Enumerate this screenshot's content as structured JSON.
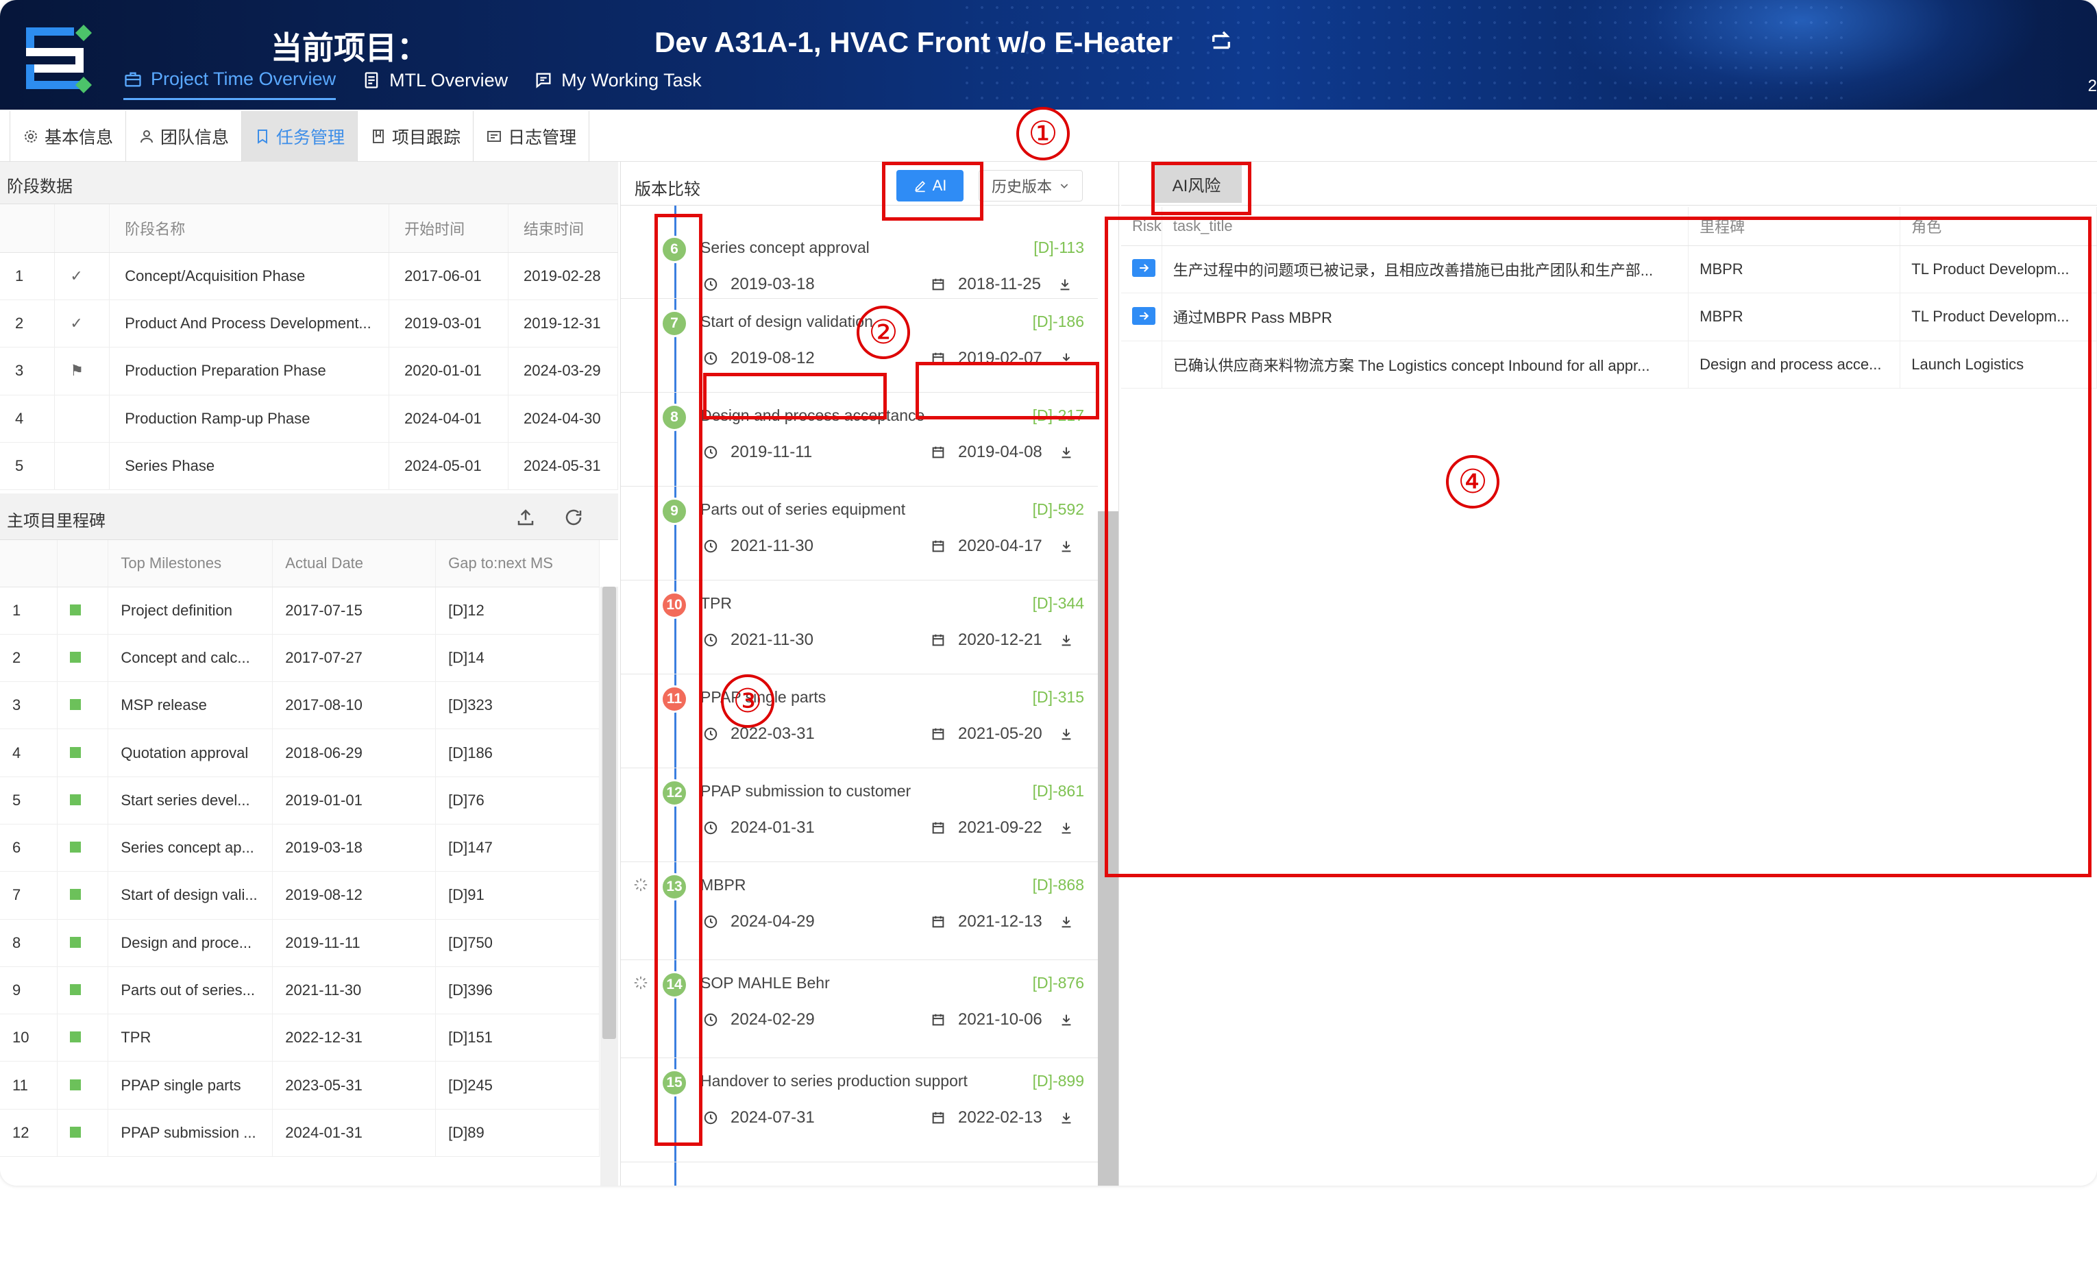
{
  "header": {
    "project_label": "当前项目：",
    "project_name": "Dev A31A-1, HVAC Front w/o E-Heater",
    "nav": [
      {
        "label": "Project Time Overview",
        "icon": "briefcase-icon",
        "active": true
      },
      {
        "label": "MTL Overview",
        "icon": "document-icon",
        "active": false
      },
      {
        "label": "My Working Task",
        "icon": "message-icon",
        "active": false
      }
    ],
    "right_number": "2"
  },
  "subtabs": [
    {
      "label": "基本信息",
      "icon": "gear-icon",
      "active": false
    },
    {
      "label": "团队信息",
      "icon": "user-icon",
      "active": false
    },
    {
      "label": "任务管理",
      "icon": "bookmark-icon",
      "active": true
    },
    {
      "label": "项目跟踪",
      "icon": "tracking-icon",
      "active": false
    },
    {
      "label": "日志管理",
      "icon": "log-icon",
      "active": false
    }
  ],
  "stage": {
    "title": "阶段数据",
    "columns": [
      "",
      "",
      "阶段名称",
      "开始时间",
      "结束时间"
    ],
    "rows": [
      {
        "no": "1",
        "mark": "✓",
        "name": "Concept/Acquisition Phase",
        "start": "2017-06-01",
        "end": "2019-02-28"
      },
      {
        "no": "2",
        "mark": "✓",
        "name": "Product And Process Development...",
        "start": "2019-03-01",
        "end": "2019-12-31"
      },
      {
        "no": "3",
        "mark": "⚑",
        "name": "Production Preparation Phase",
        "start": "2020-01-01",
        "end": "2024-03-29"
      },
      {
        "no": "4",
        "mark": "",
        "name": "Production Ramp-up Phase",
        "start": "2024-04-01",
        "end": "2024-04-30"
      },
      {
        "no": "5",
        "mark": "",
        "name": "Series Phase",
        "start": "2024-05-01",
        "end": "2024-05-31"
      }
    ]
  },
  "milestones": {
    "title": "主项目里程碑",
    "columns": [
      "",
      "",
      "Top Milestones",
      "Actual Date",
      "Gap to:next MS"
    ],
    "rows": [
      {
        "no": "1",
        "name": "Project definition",
        "date": "2017-07-15",
        "gap": "[D]12"
      },
      {
        "no": "2",
        "name": "Concept and calc...",
        "date": "2017-07-27",
        "gap": "[D]14"
      },
      {
        "no": "3",
        "name": "MSP release",
        "date": "2017-08-10",
        "gap": "[D]323"
      },
      {
        "no": "4",
        "name": "Quotation approval",
        "date": "2018-06-29",
        "gap": "[D]186"
      },
      {
        "no": "5",
        "name": "Start series devel...",
        "date": "2019-01-01",
        "gap": "[D]76"
      },
      {
        "no": "6",
        "name": "Series concept ap...",
        "date": "2019-03-18",
        "gap": "[D]147"
      },
      {
        "no": "7",
        "name": "Start of design vali...",
        "date": "2019-08-12",
        "gap": "[D]91"
      },
      {
        "no": "8",
        "name": "Design and proce...",
        "date": "2019-11-11",
        "gap": "[D]750"
      },
      {
        "no": "9",
        "name": "Parts out of series...",
        "date": "2021-11-30",
        "gap": "[D]396"
      },
      {
        "no": "10",
        "name": "TPR",
        "date": "2022-12-31",
        "gap": "[D]151"
      },
      {
        "no": "11",
        "name": "PPAP single parts",
        "date": "2023-05-31",
        "gap": "[D]245"
      },
      {
        "no": "12",
        "name": "PPAP submission ...",
        "date": "2024-01-31",
        "gap": "[D]89"
      }
    ]
  },
  "compare": {
    "title": "版本比较",
    "ai_label": "AI",
    "history_label": "历史版本",
    "items": [
      {
        "num": "6",
        "color": "green",
        "title": "Series concept approval",
        "code": "[D]-113",
        "actual": "2019-03-18",
        "plan": "2018-11-25",
        "spin": false
      },
      {
        "num": "7",
        "color": "green",
        "title": "Start of design validation",
        "code": "[D]-186",
        "actual": "2019-08-12",
        "plan": "2019-02-07",
        "spin": false
      },
      {
        "num": "8",
        "color": "green",
        "title": "Design and process acceptance",
        "code": "[D]-217",
        "actual": "2019-11-11",
        "plan": "2019-04-08",
        "spin": false
      },
      {
        "num": "9",
        "color": "green",
        "title": "Parts out of series equipment",
        "code": "[D]-592",
        "actual": "2021-11-30",
        "plan": "2020-04-17",
        "spin": false
      },
      {
        "num": "10",
        "color": "red",
        "title": "TPR",
        "code": "[D]-344",
        "actual": "2021-11-30",
        "plan": "2020-12-21",
        "spin": false
      },
      {
        "num": "11",
        "color": "red",
        "title": "PPAP single parts",
        "code": "[D]-315",
        "actual": "2022-03-31",
        "plan": "2021-05-20",
        "spin": false
      },
      {
        "num": "12",
        "color": "green",
        "title": "PPAP submission to customer",
        "code": "[D]-861",
        "actual": "2024-01-31",
        "plan": "2021-09-22",
        "spin": false
      },
      {
        "num": "13",
        "color": "green",
        "title": "MBPR",
        "code": "[D]-868",
        "actual": "2024-04-29",
        "plan": "2021-12-13",
        "spin": true
      },
      {
        "num": "14",
        "color": "green",
        "title": "SOP MAHLE Behr",
        "code": "[D]-876",
        "actual": "2024-02-29",
        "plan": "2021-10-06",
        "spin": true
      },
      {
        "num": "15",
        "color": "green",
        "title": "Handover to series production support",
        "code": "[D]-899",
        "actual": "2024-07-31",
        "plan": "2022-02-13",
        "spin": false
      }
    ]
  },
  "ai_risk": {
    "tab_label": "AI风险",
    "columns": [
      "Risk",
      "task_title",
      "里程碑",
      "角色"
    ],
    "rows": [
      {
        "has_arrow": true,
        "task_title": "生产过程中的问题项已被记录，且相应改善措施已由批产团队和生产部...",
        "milestone": "MBPR",
        "role": "TL Product Developm..."
      },
      {
        "has_arrow": true,
        "task_title": "通过MBPR Pass MBPR",
        "milestone": "MBPR",
        "role": "TL Product Developm..."
      },
      {
        "has_arrow": false,
        "task_title": "已确认供应商来料物流方案 The Logistics concept Inbound for all appr...",
        "milestone": "Design and process acce...",
        "role": "Launch Logistics"
      }
    ]
  },
  "annotations": [
    "①",
    "②",
    "③",
    "④"
  ],
  "colors": {
    "accent": "#2f8cf5",
    "green": "#8cc56e",
    "red": "#f26b5a",
    "annotation": "#e20a0a"
  }
}
